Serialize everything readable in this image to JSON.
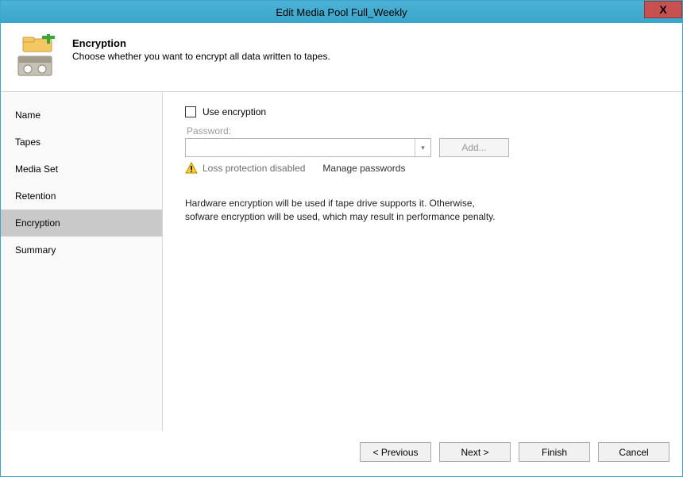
{
  "window": {
    "title": "Edit Media Pool Full_Weekly"
  },
  "header": {
    "title": "Encryption",
    "subtitle": "Choose whether you want to encrypt all data written to tapes."
  },
  "sidebar": {
    "items": [
      {
        "label": "Name",
        "id": "name"
      },
      {
        "label": "Tapes",
        "id": "tapes"
      },
      {
        "label": "Media Set",
        "id": "mediaset"
      },
      {
        "label": "Retention",
        "id": "retention"
      },
      {
        "label": "Encryption",
        "id": "encryption"
      },
      {
        "label": "Summary",
        "id": "summary"
      }
    ],
    "selected": "encryption"
  },
  "content": {
    "useEncryptionLabel": "Use encryption",
    "passwordLabel": "Password:",
    "addButton": "Add...",
    "lossProtection": "Loss protection disabled",
    "managePasswords": "Manage passwords",
    "infoLine1": "Hardware encryption will be used if tape drive supports it. Otherwise,",
    "infoLine2": "sofware encryption will be used, which may result in performance penalty."
  },
  "footer": {
    "previous": "< Previous",
    "next": "Next >",
    "finish": "Finish",
    "cancel": "Cancel"
  }
}
